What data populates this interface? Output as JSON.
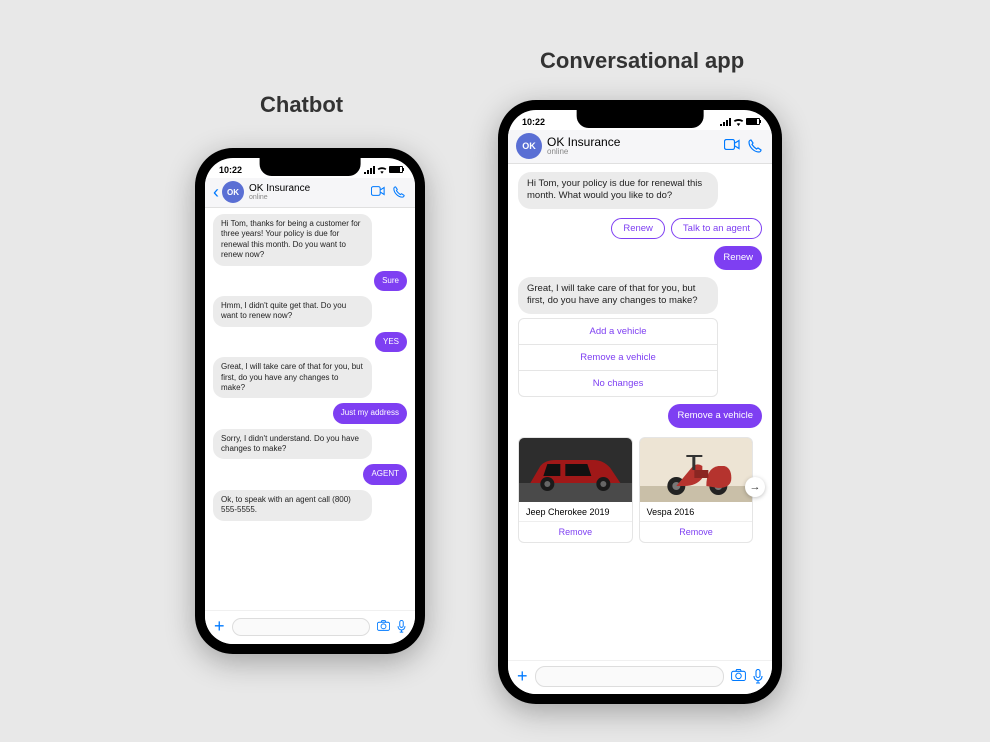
{
  "labels": {
    "chatbot": "Chatbot",
    "conversational": "Conversational app"
  },
  "status_time": "10:22",
  "header": {
    "avatar_initials": "OK",
    "title": "OK Insurance",
    "status": "online"
  },
  "chatbot_conversation": [
    {
      "role": "bot",
      "text": "Hi Tom, thanks for being a customer for three years! Your policy is due for renewal this month. Do you want to renew now?"
    },
    {
      "role": "user",
      "text": "Sure"
    },
    {
      "role": "bot",
      "text": "Hmm, I didn't quite get that. Do you want to renew now?"
    },
    {
      "role": "user",
      "text": "YES"
    },
    {
      "role": "bot",
      "text": "Great, I will take care of that for you, but first, do you have any changes to make?"
    },
    {
      "role": "user",
      "text": "Just my address"
    },
    {
      "role": "bot",
      "text": "Sorry, I didn't understand. Do you have changes to make?"
    },
    {
      "role": "user",
      "text": "AGENT"
    },
    {
      "role": "bot",
      "text": "Ok, to speak with an agent call (800) 555-5555."
    }
  ],
  "conv_app": {
    "intro": "Hi Tom, your policy is due for renewal this month. What would you like to do?",
    "intro_chips": [
      "Renew",
      "Talk to an agent"
    ],
    "user_choice_1": "Renew",
    "followup_bot": "Great, I will take care of that for you, but first, do you have any changes to make?",
    "options": [
      "Add a vehicle",
      "Remove a vehicle",
      "No changes"
    ],
    "user_choice_2": "Remove a vehicle",
    "vehicles": [
      {
        "name": "Jeep Cherokee 2019",
        "action": "Remove"
      },
      {
        "name": "Vespa 2016",
        "action": "Remove"
      }
    ]
  },
  "colors": {
    "accent": "#7e3ff2",
    "ios_blue": "#007aff"
  }
}
